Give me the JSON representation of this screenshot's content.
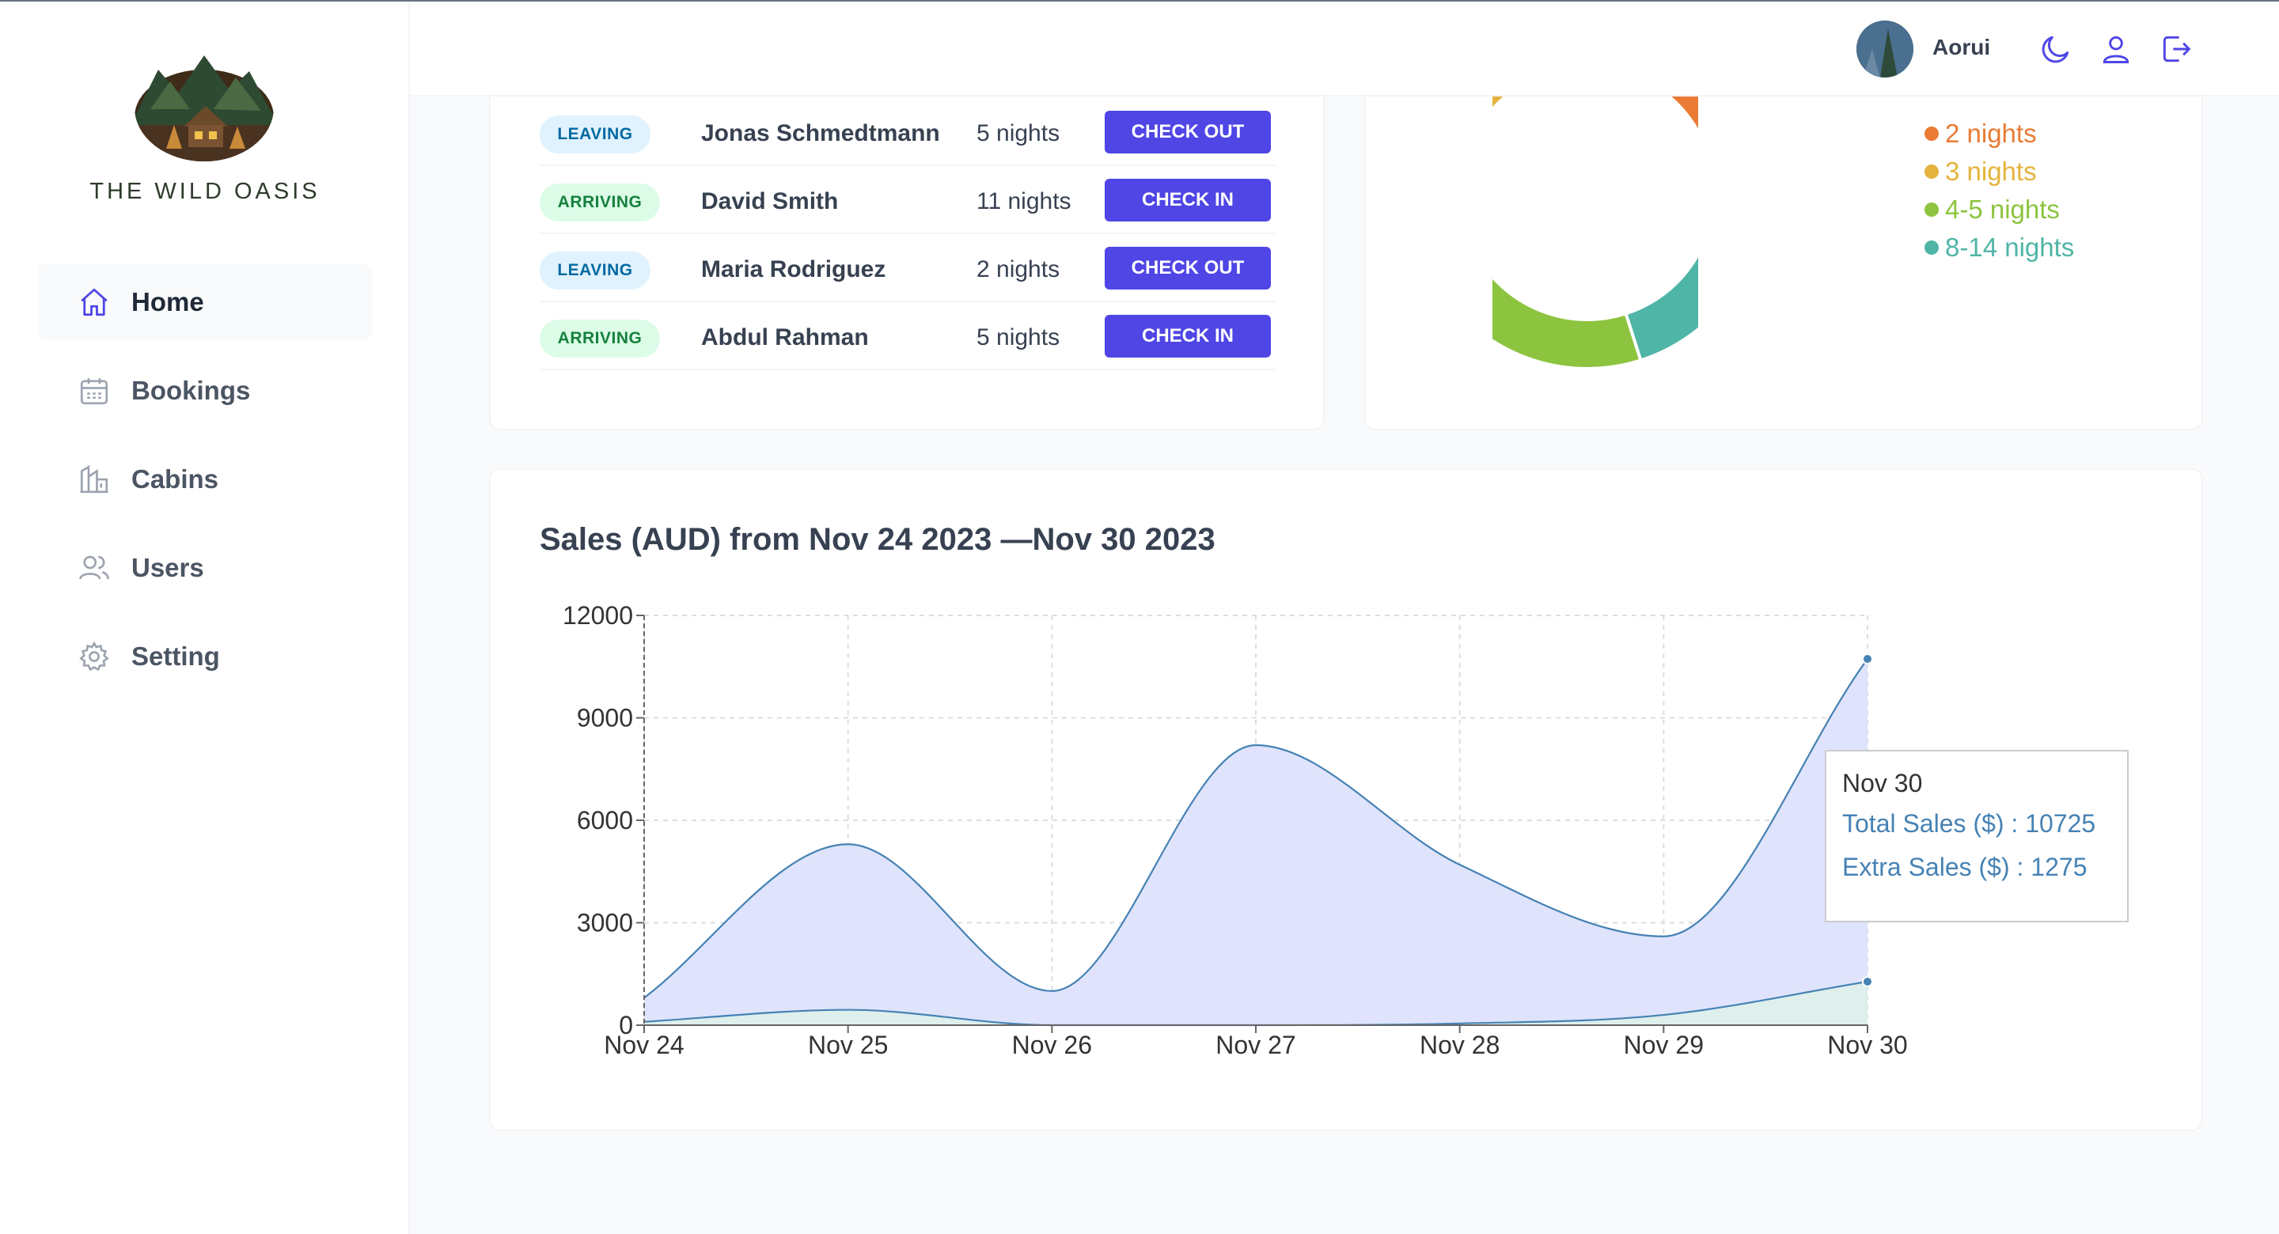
{
  "brand": {
    "name": "THE WILD OASIS"
  },
  "sidebar": {
    "items": [
      {
        "label": "Home",
        "icon": "home-icon",
        "active": true
      },
      {
        "label": "Bookings",
        "icon": "calendar-icon",
        "active": false
      },
      {
        "label": "Cabins",
        "icon": "cabin-icon",
        "active": false
      },
      {
        "label": "Users",
        "icon": "users-icon",
        "active": false
      },
      {
        "label": "Setting",
        "icon": "gear-icon",
        "active": false
      }
    ]
  },
  "header": {
    "user_name": "Aorui",
    "icons": [
      "moon-icon",
      "user-icon",
      "logout-icon"
    ]
  },
  "today_activity": {
    "rows": [
      {
        "status": "LEAVING",
        "guest": "Jonas Schmedtmann",
        "nights": "5 nights",
        "action": "CHECK OUT"
      },
      {
        "status": "ARRIVING",
        "guest": "David Smith",
        "nights": "11 nights",
        "action": "CHECK IN"
      },
      {
        "status": "LEAVING",
        "guest": "Maria Rodriguez",
        "nights": "2 nights",
        "action": "CHECK OUT"
      },
      {
        "status": "ARRIVING",
        "guest": "Abdul Rahman",
        "nights": "5 nights",
        "action": "CHECK IN"
      }
    ]
  },
  "stay_summary": {
    "legend": [
      {
        "label": "2 nights",
        "color": "#ea7b34"
      },
      {
        "label": "3 nights",
        "color": "#e4b33c"
      },
      {
        "label": "4-5 nights",
        "color": "#8cc43f"
      },
      {
        "label": "8-14 nights",
        "color": "#4fb5a6"
      }
    ]
  },
  "colors": {
    "accent": "#4f46e5",
    "total_sales_fill": "#dde3fc",
    "extra_sales_fill": "#def0ea",
    "line": "#4682b4"
  },
  "sales": {
    "title": "Sales (AUD) from Nov 24 2023 —Nov 30 2023",
    "tooltip": {
      "date": "Nov 30",
      "total_label": "Total Sales ($) : 10725",
      "extra_label": "Extra Sales ($) : 1275"
    }
  },
  "chart_data": [
    {
      "type": "pie",
      "title": "",
      "categories": [
        "2 nights",
        "3 nights",
        "4-5 nights",
        "8-14 nights"
      ],
      "values": [
        1,
        2,
        1,
        1
      ],
      "donut": true,
      "colors": [
        "#ea7b34",
        "#e4b33c",
        "#8cc43f",
        "#4fb5a6"
      ],
      "legend": "right"
    },
    {
      "type": "area",
      "title": "Sales (AUD) from Nov 24 2023 —Nov 30 2023",
      "xlabel": "",
      "ylabel": "",
      "categories": [
        "Nov 24",
        "Nov 25",
        "Nov 26",
        "Nov 27",
        "Nov 28",
        "Nov 29",
        "Nov 30"
      ],
      "yticks": [
        0,
        3000,
        6000,
        9000,
        12000
      ],
      "ylim": [
        0,
        12000
      ],
      "grid": true,
      "series": [
        {
          "name": "Total Sales ($)",
          "values": [
            800,
            5300,
            1000,
            8200,
            4700,
            2600,
            10725
          ]
        },
        {
          "name": "Extra Sales ($)",
          "values": [
            100,
            450,
            0,
            0,
            50,
            300,
            1275
          ]
        }
      ]
    }
  ]
}
